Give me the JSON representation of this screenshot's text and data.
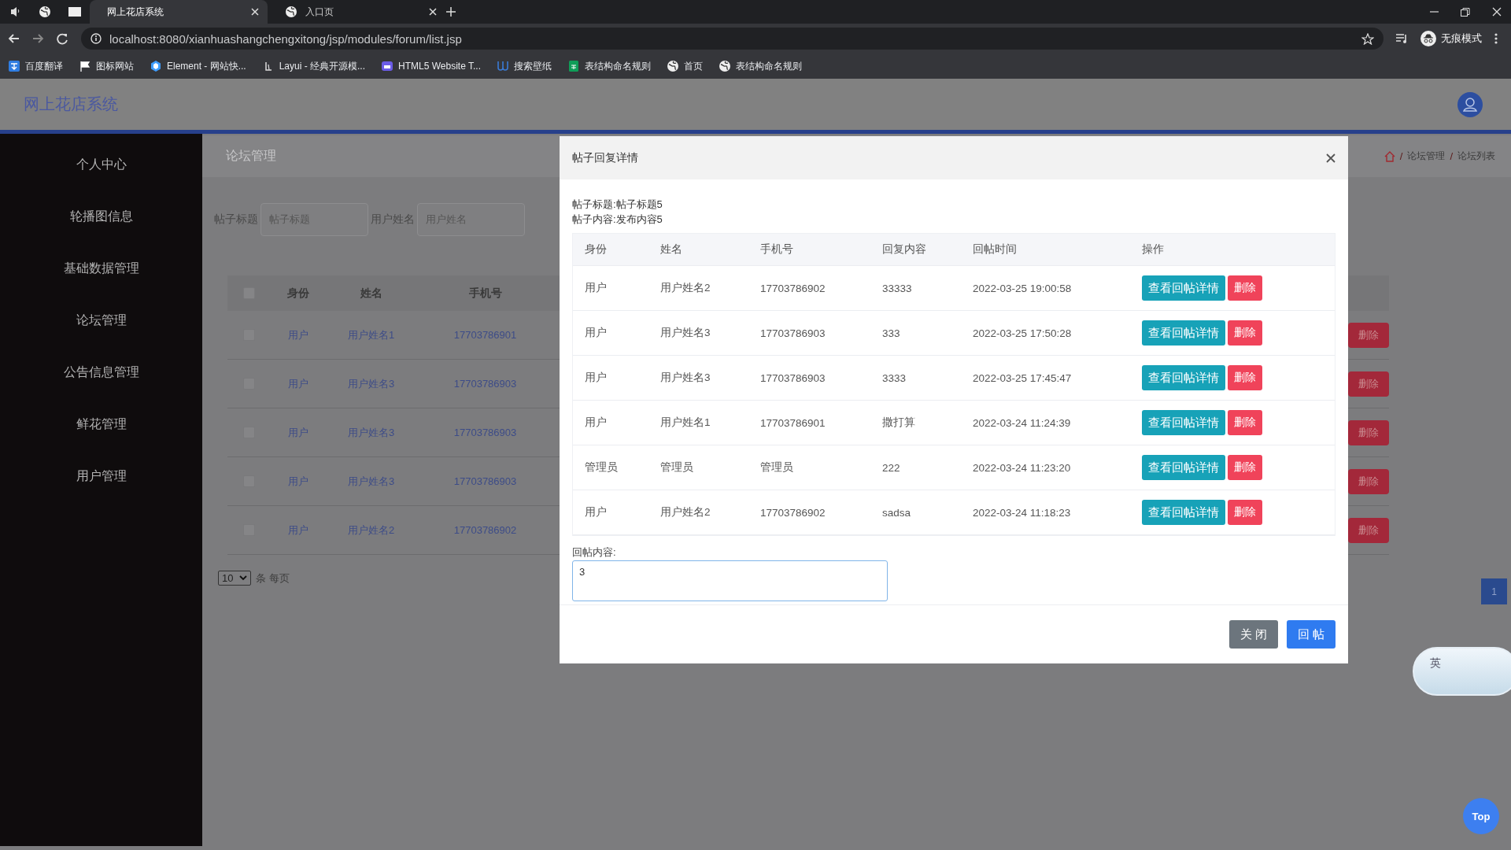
{
  "browser": {
    "tabs": [
      {
        "title": "网上花店系统",
        "selected": true
      },
      {
        "title": "入口页",
        "selected": false
      }
    ],
    "address": "localhost:8080/xianhuashangchengxitong/jsp/modules/forum/list.jsp",
    "profile": "无痕模式",
    "bookmarks": [
      {
        "label": "百度翻译",
        "kind": "translate"
      },
      {
        "label": "图标网站",
        "kind": "flag"
      },
      {
        "label": "Element - 网站快...",
        "kind": "hex"
      },
      {
        "label": "Layui - 经典开源模...",
        "kind": "layui"
      },
      {
        "label": "HTML5 Website T...",
        "kind": "html5"
      },
      {
        "label": "搜索壁纸",
        "kind": "wallpaper"
      },
      {
        "label": "表结构命名规则",
        "kind": "sheet"
      },
      {
        "label": "首页",
        "kind": "globe"
      },
      {
        "label": "表结构命名规则",
        "kind": "globe"
      }
    ]
  },
  "header": {
    "title": "网上花店系统"
  },
  "sidebar": {
    "items": [
      {
        "label": "个人中心"
      },
      {
        "label": "轮播图信息"
      },
      {
        "label": "基础数据管理"
      },
      {
        "label": "论坛管理"
      },
      {
        "label": "公告信息管理"
      },
      {
        "label": "鲜花管理"
      },
      {
        "label": "用户管理"
      }
    ]
  },
  "page": {
    "section_title": "论坛管理",
    "breadcrumb": [
      "论坛管理",
      "论坛列表"
    ],
    "breadcrumb_separator": "/",
    "select_all_checked": false,
    "filters": [
      {
        "label": "帖子标题",
        "placeholder": "帖子标题"
      },
      {
        "label": "用户姓名",
        "placeholder": "用户姓名"
      }
    ],
    "columns": [
      "身份",
      "姓名",
      "手机号"
    ],
    "rows": [
      {
        "checked": false,
        "identity": "用户",
        "name": "用户姓名1",
        "phone": "17703786901",
        "action": "删除"
      },
      {
        "checked": false,
        "identity": "用户",
        "name": "用户姓名3",
        "phone": "17703786903",
        "action": "删除"
      },
      {
        "checked": false,
        "identity": "用户",
        "name": "用户姓名3",
        "phone": "17703786903",
        "action": "删除"
      },
      {
        "checked": false,
        "identity": "用户",
        "name": "用户姓名3",
        "phone": "17703786903",
        "action": "删除"
      },
      {
        "checked": false,
        "identity": "用户",
        "name": "用户姓名2",
        "phone": "17703786902",
        "action": "删除"
      }
    ],
    "page_size": "10",
    "page_size_suffix": "条 每页",
    "pages": [
      {
        "label": "1",
        "selected": true
      }
    ]
  },
  "dialog": {
    "title": "帖子回复详情",
    "info": [
      "帖子标题:帖子标题5",
      "帖子内容:发布内容5"
    ],
    "columns": [
      "身份",
      "姓名",
      "手机号",
      "回复内容",
      "回帖时间",
      "操作"
    ],
    "rows": [
      {
        "identity": "用户",
        "name": "用户姓名2",
        "phone": "17703786902",
        "content": "33333",
        "time": "2022-03-25 19:00:58",
        "view": "查看回帖详情",
        "delete": "删除"
      },
      {
        "identity": "用户",
        "name": "用户姓名3",
        "phone": "17703786903",
        "content": "333",
        "time": "2022-03-25 17:50:28",
        "view": "查看回帖详情",
        "delete": "删除"
      },
      {
        "identity": "用户",
        "name": "用户姓名3",
        "phone": "17703786903",
        "content": "3333",
        "time": "2022-03-25 17:45:47",
        "view": "查看回帖详情",
        "delete": "删除"
      },
      {
        "identity": "用户",
        "name": "用户姓名1",
        "phone": "17703786901",
        "content": "撒打算",
        "time": "2022-03-24 11:24:39",
        "view": "查看回帖详情",
        "delete": "删除"
      },
      {
        "identity": "管理员",
        "name": "管理员",
        "phone": "管理员",
        "content": "222",
        "time": "2022-03-24 11:23:20",
        "view": "查看回帖详情",
        "delete": "删除"
      },
      {
        "identity": "用户",
        "name": "用户姓名2",
        "phone": "17703786902",
        "content": "sadsa",
        "time": "2022-03-24 11:18:23",
        "view": "查看回帖详情",
        "delete": "删除"
      }
    ],
    "reply_label": "回帖内容:",
    "reply_value": "3",
    "buttons": [
      {
        "label": "关 闭",
        "kind": "close"
      },
      {
        "label": "回 帖",
        "kind": "submit"
      }
    ]
  },
  "ime": {
    "label": "英"
  },
  "top_button": "Top"
}
